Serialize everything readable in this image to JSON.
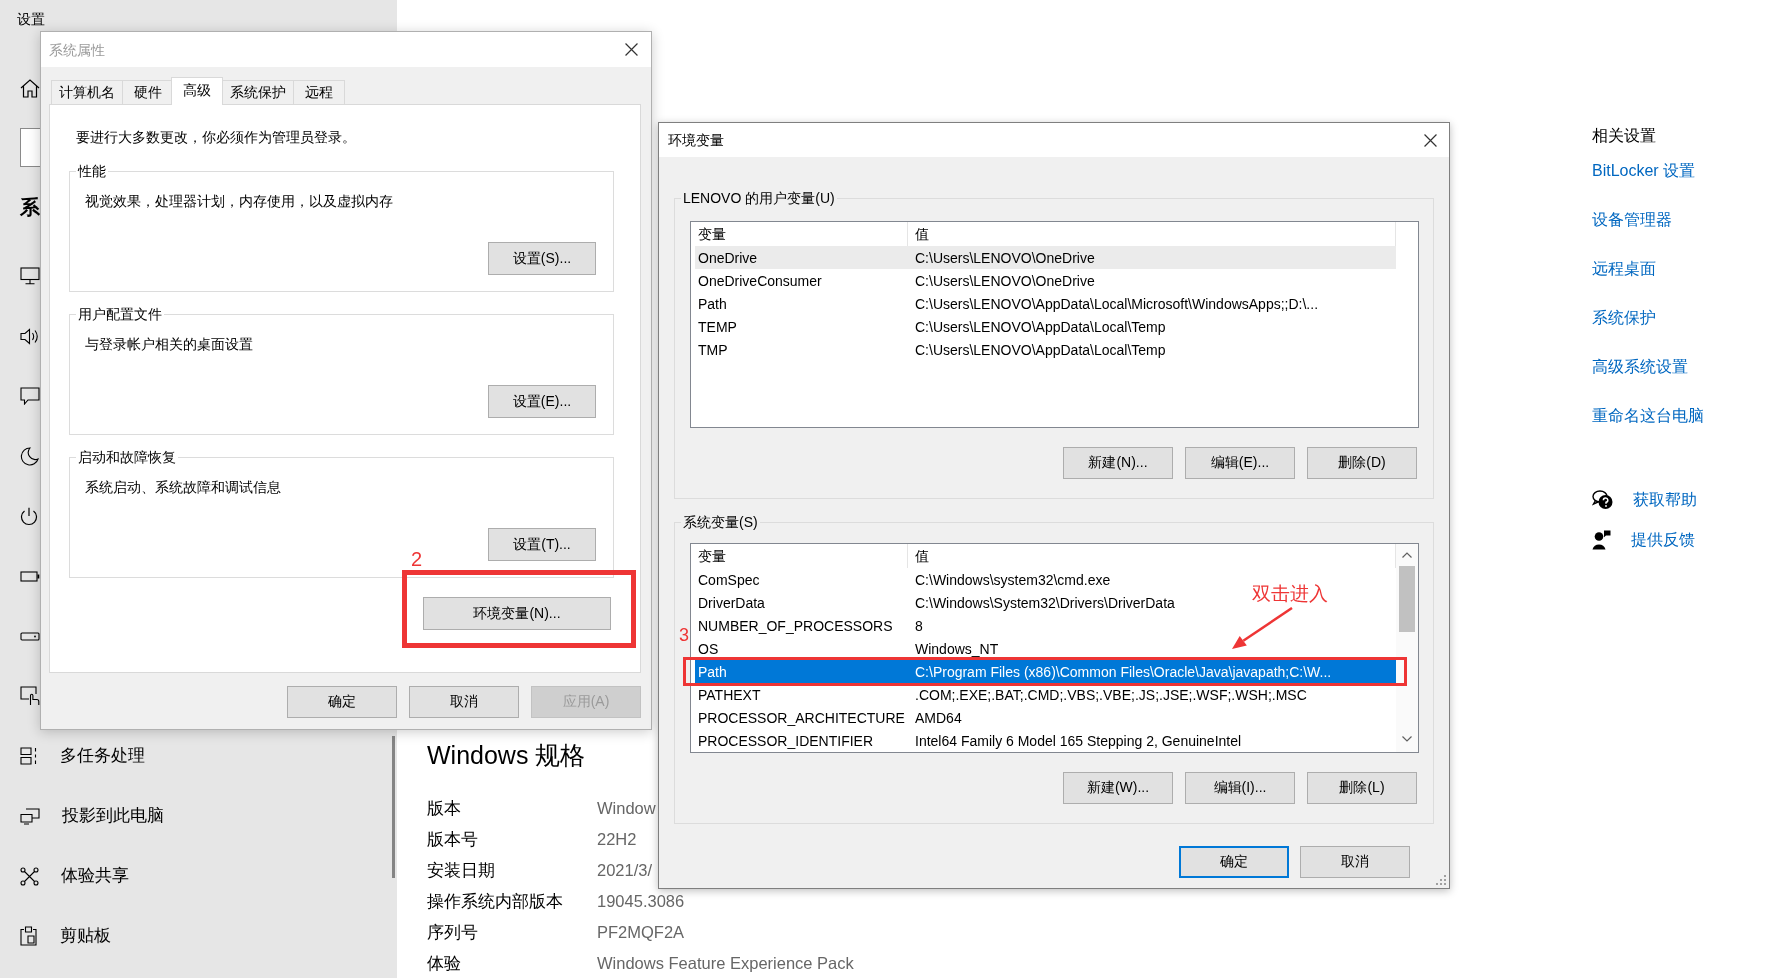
{
  "settings_window": {
    "title": "设置",
    "sidebar": {
      "heading": "系",
      "items": [
        {
          "label": "多任务处理"
        },
        {
          "label": "投影到此电脑"
        },
        {
          "label": "体验共享"
        },
        {
          "label": "剪贴板"
        }
      ]
    },
    "windows_specs": {
      "title": "Windows 规格",
      "rows": [
        {
          "label": "版本",
          "value": "Window"
        },
        {
          "label": "版本号",
          "value": "22H2"
        },
        {
          "label": "安装日期",
          "value": "2021/3/"
        },
        {
          "label": "操作系统内部版本",
          "value": "19045.3086"
        },
        {
          "label": "序列号",
          "value": "PF2MQF2A"
        },
        {
          "label": "体验",
          "value": "Windows Feature Experience Pack"
        }
      ]
    },
    "related_settings": {
      "title": "相关设置",
      "links": [
        "BitLocker 设置",
        "设备管理器",
        "远程桌面",
        "系统保护",
        "高级系统设置",
        "重命名这台电脑"
      ]
    },
    "support_links": [
      "获取帮助",
      "提供反馈"
    ]
  },
  "system_properties": {
    "title": "系统属性",
    "active": false,
    "tabs": [
      {
        "label": "计算机名",
        "selected": false
      },
      {
        "label": "硬件",
        "selected": false
      },
      {
        "label": "高级",
        "selected": true
      },
      {
        "label": "系统保护",
        "selected": false
      },
      {
        "label": "远程",
        "selected": false
      }
    ],
    "notice": "要进行大多数更改，你必须作为管理员登录。",
    "groups": [
      {
        "title": "性能",
        "description": "视觉效果，处理器计划，内存使用，以及虚拟内存",
        "button": "设置(S)..."
      },
      {
        "title": "用户配置文件",
        "description": "与登录帐户相关的桌面设置",
        "button": "设置(E)..."
      },
      {
        "title": "启动和故障恢复",
        "description": "系统启动、系统故障和调试信息",
        "button": "设置(T)..."
      }
    ],
    "env_button": {
      "label": "环境变量(N)...",
      "step": "2"
    },
    "buttons": [
      {
        "label": "确定",
        "disabled": false
      },
      {
        "label": "取消",
        "disabled": false
      },
      {
        "label": "应用(A)",
        "disabled": true
      }
    ]
  },
  "environment_variables": {
    "title": "环境变量",
    "active": true,
    "user_variables": {
      "title": "LENOVO 的用户变量(U)",
      "focused": false,
      "columns": [
        "变量",
        "值"
      ],
      "rows": [
        {
          "name": "OneDrive",
          "value": "C:\\Users\\LENOVO\\OneDrive",
          "selected": true
        },
        {
          "name": "OneDriveConsumer",
          "value": "C:\\Users\\LENOVO\\OneDrive",
          "selected": false
        },
        {
          "name": "Path",
          "value": "C:\\Users\\LENOVO\\AppData\\Local\\Microsoft\\WindowsApps;;D:\\...",
          "selected": false
        },
        {
          "name": "TEMP",
          "value": "C:\\Users\\LENOVO\\AppData\\Local\\Temp",
          "selected": false
        },
        {
          "name": "TMP",
          "value": "C:\\Users\\LENOVO\\AppData\\Local\\Temp",
          "selected": false
        }
      ],
      "buttons": [
        "新建(N)...",
        "编辑(E)...",
        "删除(D)"
      ]
    },
    "system_variables": {
      "title": "系统变量(S)",
      "focused": true,
      "columns": [
        "变量",
        "值"
      ],
      "rows": [
        {
          "name": "ComSpec",
          "value": "C:\\Windows\\system32\\cmd.exe",
          "selected": false
        },
        {
          "name": "DriverData",
          "value": "C:\\Windows\\System32\\Drivers\\DriverData",
          "selected": false
        },
        {
          "name": "NUMBER_OF_PROCESSORS",
          "value": "8",
          "selected": false
        },
        {
          "name": "OS",
          "value": "Windows_NT",
          "selected": false
        },
        {
          "name": "Path",
          "value": "C:\\Program Files (x86)\\Common Files\\Oracle\\Java\\javapath;C:\\W...",
          "selected": true,
          "step": "3",
          "callout": "双击进入"
        },
        {
          "name": "PATHEXT",
          "value": ".COM;.EXE;.BAT;.CMD;.VBS;.VBE;.JS;.JSE;.WSF;.WSH;.MSC",
          "selected": false
        },
        {
          "name": "PROCESSOR_ARCHITECTURE",
          "value": "AMD64",
          "selected": false
        },
        {
          "name": "PROCESSOR_IDENTIFIER",
          "value": "Intel64 Family 6 Model 165 Stepping 2, GenuineIntel",
          "selected": false
        }
      ],
      "buttons": [
        "新建(W)...",
        "编辑(I)...",
        "删除(L)"
      ]
    },
    "buttons": [
      {
        "label": "确定",
        "default": true
      },
      {
        "label": "取消",
        "default": false
      }
    ]
  }
}
